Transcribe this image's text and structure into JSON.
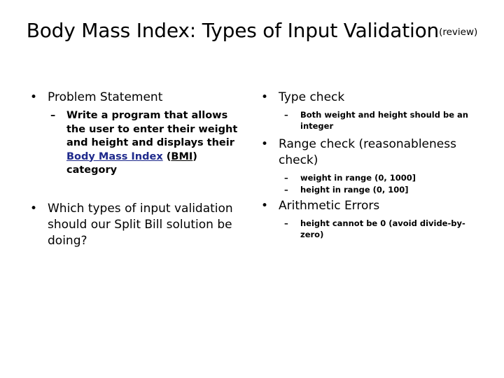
{
  "slide": {
    "title_main": "Body Mass Index: Types of Input Validation",
    "title_suffix": "(review)",
    "bullet_glyph": "•",
    "dash_glyph": "–",
    "link_color": "#1F2A8C",
    "text_color": "#000000",
    "background_color": "#FFFFFF"
  },
  "left_column": {
    "b1": {
      "label": "Problem Statement",
      "sub1": {
        "prefix": "Write a program that allows the user to enter their weight and height and displays their ",
        "link_text": "Body Mass Index",
        "mid": " (",
        "underlined_text": "BMI",
        "suffix": ") category"
      }
    },
    "b2": {
      "label": "Which types of input validation should our Split Bill solution be doing?"
    }
  },
  "right_column": {
    "b1": {
      "label": "Type check",
      "subs": [
        "Both weight and height should be an integer"
      ]
    },
    "b2": {
      "label": "Range check (reasonableness check)",
      "subs": [
        "weight in range (0, 1000]",
        "height in range (0, 100]"
      ]
    },
    "b3": {
      "label": "Arithmetic Errors",
      "subs": [
        "height cannot be 0 (avoid divide-by-zero)"
      ]
    }
  }
}
